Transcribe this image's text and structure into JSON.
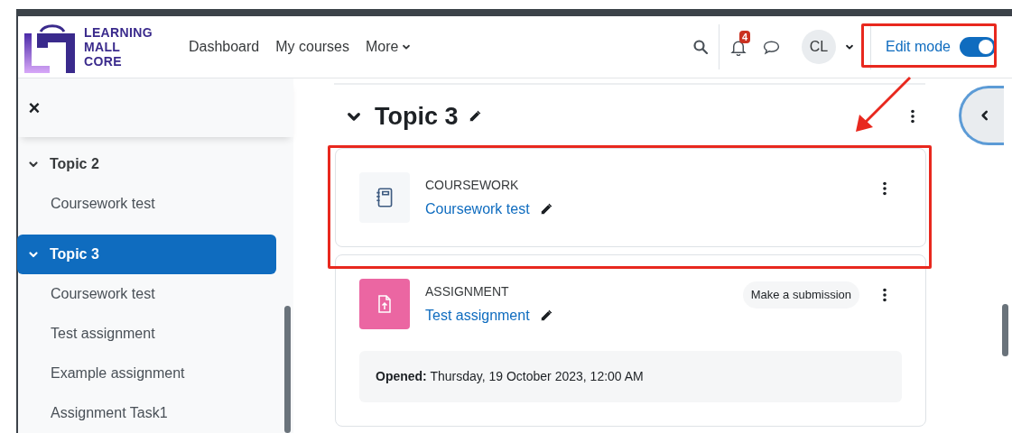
{
  "header": {
    "logo_lines": [
      "LEARNING",
      "MALL",
      "CORE"
    ],
    "nav": [
      {
        "label": "Dashboard",
        "kind": "link"
      },
      {
        "label": "My courses",
        "kind": "link"
      },
      {
        "label": "More",
        "kind": "dropdown"
      }
    ],
    "notification_count": "4",
    "avatar": "CL",
    "edit_mode": {
      "label": "Edit mode",
      "on": true
    }
  },
  "sidebar": {
    "close": "×",
    "sections": [
      {
        "title": "Topic 2",
        "expanded": true,
        "selected": false,
        "items": [
          "Coursework test"
        ]
      },
      {
        "title": "Topic 3",
        "expanded": true,
        "selected": true,
        "items": [
          "Coursework test",
          "Test assignment",
          "Example assignment",
          "Assignment Task1"
        ]
      }
    ]
  },
  "section": {
    "title": "Topic 3",
    "expanded": true,
    "activities": [
      {
        "kind": "coursework",
        "type_label": "COURSEWORK",
        "name": "Coursework test"
      },
      {
        "kind": "assignment",
        "type_label": "ASSIGNMENT",
        "name": "Test assignment",
        "action": "Make a submission",
        "dates": [
          {
            "label": "Opened:",
            "value": "Thursday, 19 October 2023, 12:00 AM"
          }
        ]
      }
    ]
  }
}
